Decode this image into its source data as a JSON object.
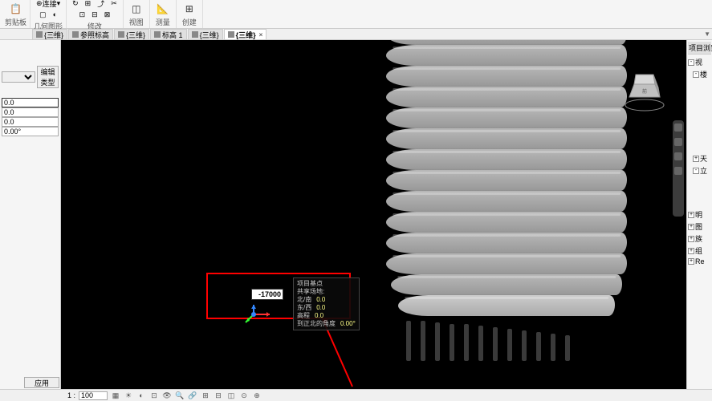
{
  "ribbon": {
    "groups": [
      {
        "label": "剪贴板",
        "big_icon": "📋"
      },
      {
        "label": "几何图形",
        "items": [
          "连接",
          "▢",
          "◐"
        ]
      },
      {
        "label": "修改",
        "small_icons": [
          "⟳",
          "↔",
          "⊞",
          "⤾",
          "✂",
          "⊡"
        ]
      },
      {
        "label": "视图",
        "big_icon": "◫"
      },
      {
        "label": "测量",
        "big_icon": "📏"
      },
      {
        "label": "创建",
        "big_icon": "⊞"
      }
    ],
    "connect_label": "连接"
  },
  "tabs": [
    {
      "label": "{三维}",
      "active": false
    },
    {
      "label": "参照标高",
      "active": false
    },
    {
      "label": "{三维}",
      "active": false
    },
    {
      "label": "标高 1",
      "active": false
    },
    {
      "label": "{三维}",
      "active": false
    },
    {
      "label": "{三维}",
      "active": true
    }
  ],
  "properties": {
    "edit_type": "编辑类型",
    "values": [
      "0.0",
      "0.0",
      "0.0",
      "0.00°"
    ],
    "active_value": "0.0"
  },
  "annotation": {
    "title": "项目基点",
    "shared_site": "共享场地:",
    "rows": [
      {
        "k": "北/南",
        "v": "0.0"
      },
      {
        "k": "东/西",
        "v": "0.0"
      },
      {
        "k": "高程",
        "v": "0.0"
      },
      {
        "k": "到正北的角度",
        "v": "0.00°"
      }
    ],
    "input_value": "-17000"
  },
  "right_panel": {
    "title": "项目浏览器",
    "tree": [
      "视",
      "楼",
      "",
      "",
      "",
      "",
      "",
      "",
      "",
      "天",
      "立",
      "",
      "",
      "明",
      "图",
      "族",
      "组",
      "Re"
    ]
  },
  "status": {
    "apply": "应用",
    "scale_prefix": "1 :",
    "scale_value": "100"
  }
}
